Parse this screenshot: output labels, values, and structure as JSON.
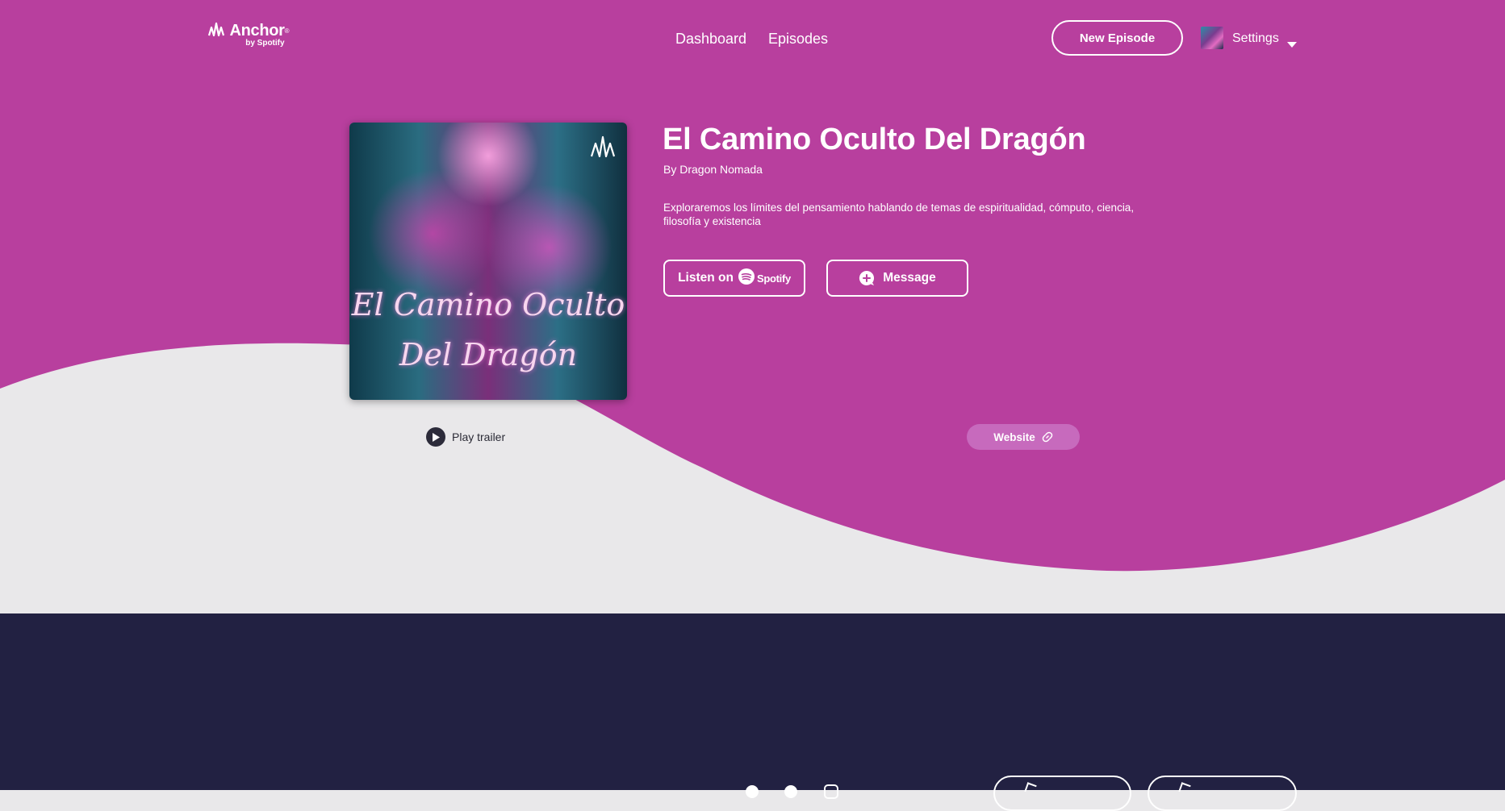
{
  "header": {
    "logo": {
      "name": "Anchor",
      "reg": "®",
      "sub": "by Spotify"
    },
    "nav": {
      "dashboard": "Dashboard",
      "episodes": "Episodes"
    },
    "new_episode": "New Episode",
    "settings": "Settings"
  },
  "podcast": {
    "cover_line1": "El Camino Oculto",
    "cover_line2": "Del Dragón",
    "title": "El Camino Oculto Del Dragón",
    "author": "By Dragon Nomada",
    "description": "Exploraremos los límites del pensamiento hablando de temas de espiritualidad, cómputo, ciencia, filosofía y existencia",
    "listen_label": "Listen on",
    "spotify_word": "Spotify",
    "message_label": "Message",
    "play_trailer": "Play trailer",
    "website": "Website"
  },
  "colors": {
    "brand": "#b83f9e",
    "page_bg": "#e9e8ea",
    "footer_bg": "#222142",
    "website_pill": "#c76abd"
  },
  "icons": [
    "anchor-logo-icon",
    "caret-down-icon",
    "spotify-icon",
    "message-plus-icon",
    "play-icon",
    "link-icon",
    "facebook-icon",
    "twitter-icon",
    "instagram-icon",
    "apple-icon",
    "google-play-icon"
  ]
}
